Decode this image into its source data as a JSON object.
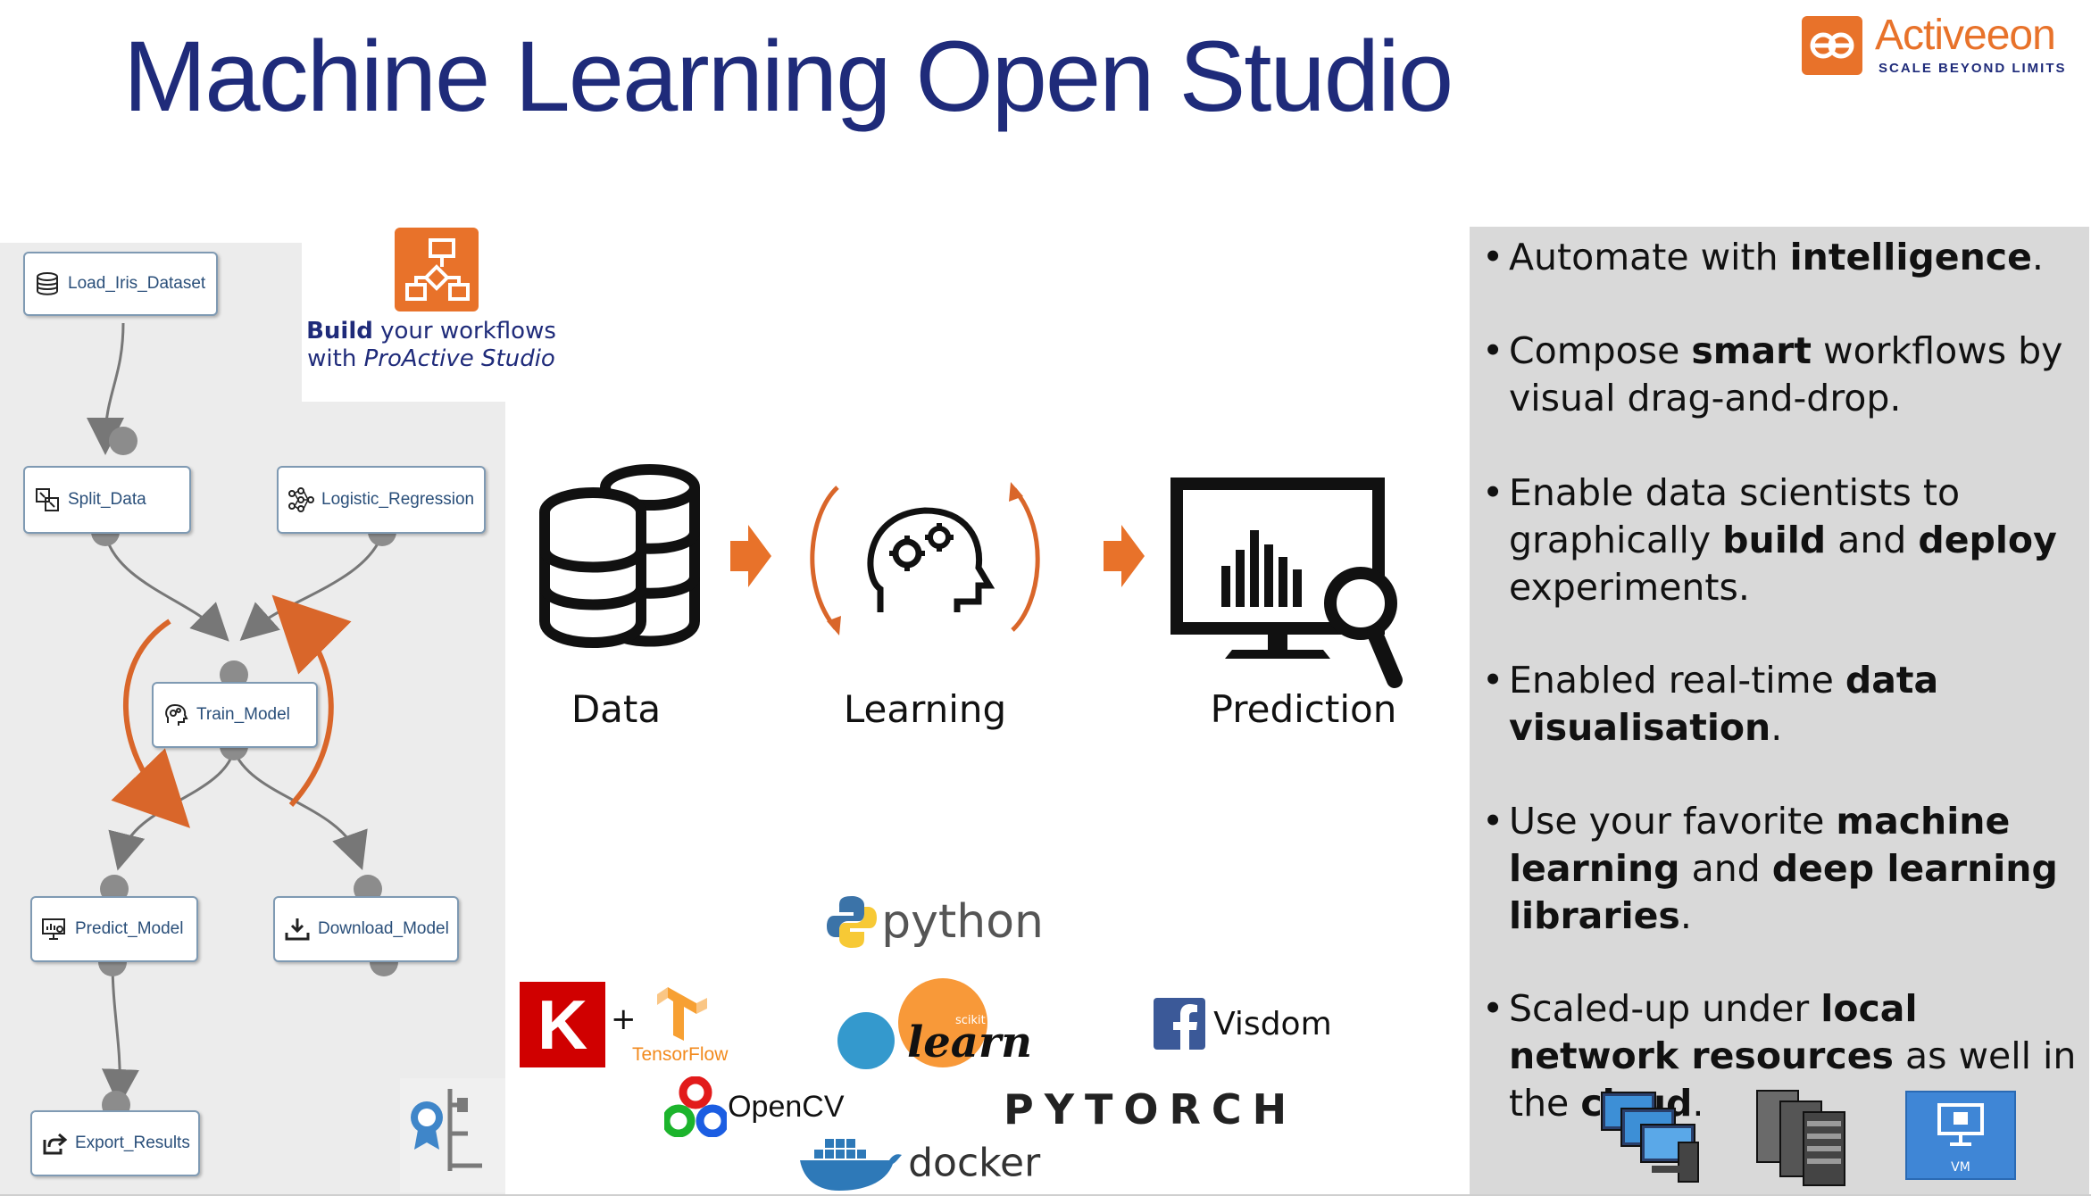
{
  "slide": {
    "title": "Machine Learning Open Studio"
  },
  "brand": {
    "name": "Activeeon",
    "tagline": "SCALE BEYOND LIMITS",
    "color": "#e8722a",
    "title_color": "#1f2b7a"
  },
  "studio_badge": {
    "bold": "Build",
    "rest": " your workflows",
    "line2_prefix": "with ",
    "line2_italic": "ProActive Studio"
  },
  "workflow": {
    "tasks": [
      {
        "label": "Load_Iris_Dataset",
        "icon": "database-icon"
      },
      {
        "label": "Split_Data",
        "icon": "split-icon"
      },
      {
        "label": "Logistic_Regression",
        "icon": "network-icon"
      },
      {
        "label": "Train_Model",
        "icon": "brain-gears-icon"
      },
      {
        "label": "Predict_Model",
        "icon": "monitor-chart-icon"
      },
      {
        "label": "Download_Model",
        "icon": "download-icon"
      },
      {
        "label": "Export_Results",
        "icon": "export-icon"
      }
    ]
  },
  "pipeline": {
    "stages": [
      {
        "label": "Data",
        "icon": "database-icon"
      },
      {
        "label": "Learning",
        "icon": "brain-gears-icon"
      },
      {
        "label": "Prediction",
        "icon": "monitor-magnifier-icon"
      }
    ]
  },
  "libraries": {
    "python": "python",
    "keras_letter": "K",
    "tensorflow": "TensorFlow",
    "sklearn_small": "scikit",
    "sklearn": "learn",
    "visdom": "Visdom",
    "opencv": "OpenCV",
    "pytorch": "PYTORCH",
    "docker": "docker"
  },
  "features": [
    {
      "parts": [
        {
          "t": "Automate with ",
          "b": false
        },
        {
          "t": "intelligence",
          "b": true
        },
        {
          "t": ".",
          "b": false
        }
      ]
    },
    {
      "parts": [
        {
          "t": "Compose ",
          "b": false
        },
        {
          "t": "smart",
          "b": true
        },
        {
          "t": " workflows by visual drag-and-drop.",
          "b": false
        }
      ]
    },
    {
      "parts": [
        {
          "t": "Enable data scientists to graphically ",
          "b": false
        },
        {
          "t": "build",
          "b": true
        },
        {
          "t": " and ",
          "b": false
        },
        {
          "t": "deploy",
          "b": true
        },
        {
          "t": " experiments.",
          "b": false
        }
      ]
    },
    {
      "parts": [
        {
          "t": "Enabled real-time ",
          "b": false
        },
        {
          "t": "data visualisation",
          "b": true
        },
        {
          "t": ".",
          "b": false
        }
      ]
    },
    {
      "parts": [
        {
          "t": "Use your favorite ",
          "b": false
        },
        {
          "t": "machine learning",
          "b": true
        },
        {
          "t": " and ",
          "b": false
        },
        {
          "t": "deep learning libraries",
          "b": true
        },
        {
          "t": ".",
          "b": false
        }
      ]
    },
    {
      "parts": [
        {
          "t": "Scaled-up under ",
          "b": false
        },
        {
          "t": "local network resources",
          "b": true
        },
        {
          "t": " as well in the ",
          "b": false
        },
        {
          "t": "cloud",
          "b": true
        },
        {
          "t": ".",
          "b": false
        }
      ]
    }
  ],
  "infra": {
    "vm_label": "VM"
  }
}
